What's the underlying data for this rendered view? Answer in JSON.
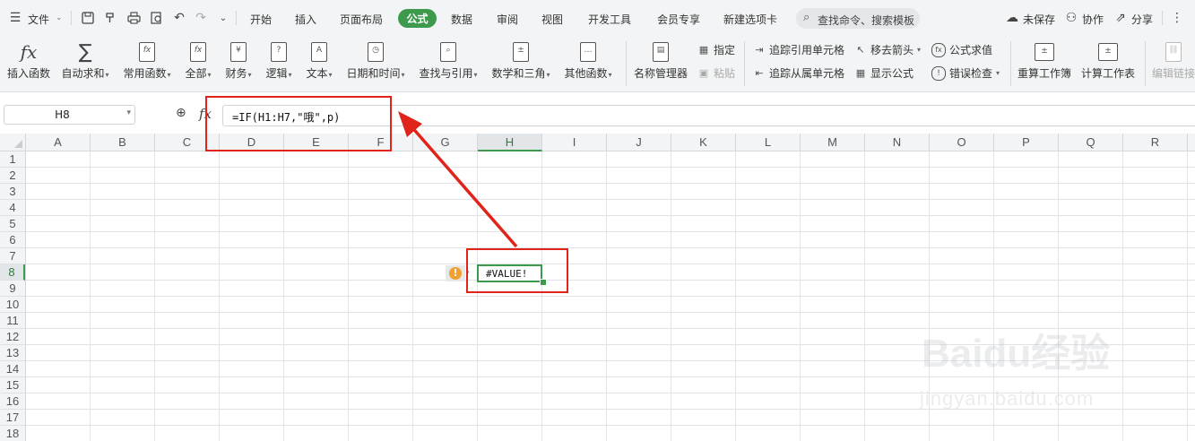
{
  "menubar": {
    "file_label": "文件",
    "tabs": [
      "开始",
      "插入",
      "页面布局",
      "公式",
      "数据",
      "审阅",
      "视图",
      "开发工具",
      "会员专享",
      "新建选项卡"
    ],
    "active_tab": "公式",
    "search_placeholder": "查找命令、搜索模板",
    "unsaved_label": "未保存",
    "collab_label": "协作",
    "share_label": "分享"
  },
  "ribbon": {
    "insert_function": "插入函数",
    "autosum": "自动求和",
    "common_functions": "常用函数",
    "all": "全部",
    "finance": "财务",
    "logic": "逻辑",
    "text": "文本",
    "datetime": "日期和时间",
    "lookup": "查找与引用",
    "math": "数学和三角",
    "other_functions": "其他函数",
    "name_manager": "名称管理器",
    "assign": "指定",
    "paste": "粘贴",
    "trace_precedents": "追踪引用单元格",
    "trace_dependents": "追踪从属单元格",
    "remove_arrows": "移去箭头",
    "show_formulas": "显示公式",
    "evaluate_formula": "公式求值",
    "error_check": "错误检查",
    "recalc_workbook": "重算工作簿",
    "calc_sheet": "计算工作表",
    "edit_links": "编辑链接"
  },
  "formula_bar": {
    "name_box": "H8",
    "fx_label": "fx",
    "formula": "=IF(H1:H7,\"哦\",p)"
  },
  "sheet": {
    "columns": [
      "A",
      "B",
      "C",
      "D",
      "E",
      "F",
      "G",
      "H",
      "I",
      "J",
      "K",
      "L",
      "M",
      "N",
      "O",
      "P",
      "Q",
      "R"
    ],
    "rows": [
      "1",
      "2",
      "3",
      "4",
      "5",
      "6",
      "7",
      "8",
      "9",
      "10",
      "11",
      "12",
      "13",
      "14",
      "15",
      "16",
      "17",
      "18"
    ],
    "selected_column": "H",
    "selected_row": "8",
    "active_cell_value": "#VALUE!"
  },
  "watermark": {
    "logo": "Baidu经验",
    "url": "jingyan.baidu.com"
  },
  "colors": {
    "accent_green": "#3d9a4d",
    "annotation_red": "#e0241b",
    "error_orange": "#f0a030"
  }
}
